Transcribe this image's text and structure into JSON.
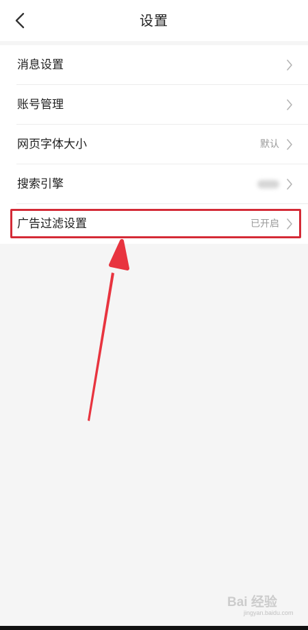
{
  "nav": {
    "title": "设置",
    "back_icon": "chevron-left-icon"
  },
  "settings": {
    "items": [
      {
        "label": "消息设置",
        "value": "",
        "value_obscured": false
      },
      {
        "label": "账号管理",
        "value": "",
        "value_obscured": false
      },
      {
        "label": "网页字体大小",
        "value": "默认",
        "value_obscured": false
      },
      {
        "label": "搜索引擎",
        "value": "",
        "value_obscured": true
      },
      {
        "label": "广告过滤设置",
        "value": "已开启",
        "value_obscured": false
      }
    ],
    "chevron_icon": "chevron-right-icon"
  },
  "annotation": {
    "highlight_color": "#d42a36",
    "arrow_color": "#e8343f",
    "highlighted_item": "广告过滤设置"
  },
  "watermark": {
    "main": "Bai  经验",
    "sub": "jingyan.baidu.com"
  }
}
